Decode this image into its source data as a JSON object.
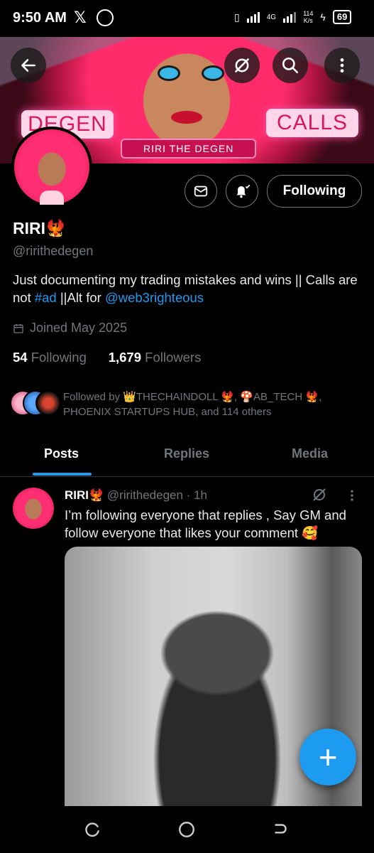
{
  "status_bar": {
    "time": "9:50 AM",
    "net_speed_top": "114",
    "net_speed_bottom": "K/s",
    "network": "4G",
    "battery": "69"
  },
  "banner": {
    "left_text": "DEGEN",
    "right_text": "CALLS",
    "name_text": "RIRI THE DEGEN"
  },
  "profile": {
    "name": "RIRI",
    "name_emoji": "🐦‍🔥",
    "handle": "@ririthedegen",
    "bio_prefix": "Just documenting my trading mistakes and wins || Calls are not ",
    "bio_hashtag": "#ad",
    "bio_middle": " ||Alt for ",
    "bio_mention": "@web3righteous",
    "joined": "Joined May 2025",
    "following_count": "54",
    "following_label": "Following",
    "followers_count": "1,679",
    "followers_label": "Followers",
    "follow_button": "Following",
    "followed_by": "Followed by 👑THECHAINDOLL 🐦‍🔥, 🍄AB_TECH 🐦‍🔥, PHOENIX STARTUPS HUB, and 114 others"
  },
  "tabs": [
    "Posts",
    "Replies",
    "Media"
  ],
  "post": {
    "author": "RIRI",
    "author_emoji": "🐦‍🔥",
    "handle_time": "@ririthedegen · 1h",
    "text": "I’m following everyone that replies , Say GM and follow everyone that likes your comment 🥰"
  },
  "icons": {
    "back": "back-arrow-icon",
    "grok": "grok-icon",
    "search": "search-icon",
    "more": "more-vertical-icon",
    "message": "envelope-icon",
    "notify": "bell-check-icon",
    "calendar": "calendar-icon",
    "compose": "plus-icon"
  },
  "colors": {
    "accent": "#1d9bf0",
    "background": "#000000",
    "muted": "#71767b"
  }
}
